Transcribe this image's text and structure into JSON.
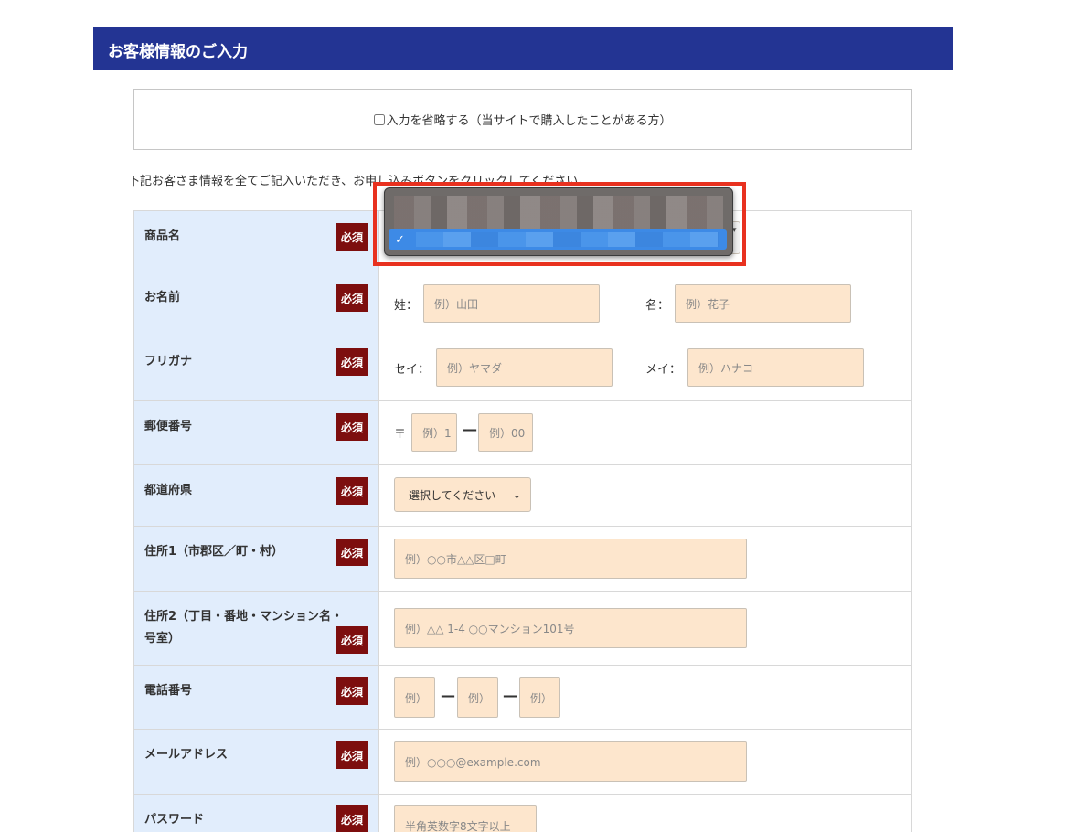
{
  "header": {
    "title": "お客様情報のご入力"
  },
  "skip": {
    "label": "入力を省略する（当サイトで購入したことがある方）"
  },
  "instruction": "下記お客さま情報を全てご記入いただき、お申し込みボタンをクリックしてください。",
  "required_label": "必須",
  "rows": {
    "product": {
      "label": "商品名"
    },
    "name": {
      "label": "お名前",
      "last_label": "姓：",
      "last_ph": "例）山田",
      "first_label": "名：",
      "first_ph": "例）花子"
    },
    "kana": {
      "label": "フリガナ",
      "last_label": "セイ：",
      "last_ph": "例）ヤマダ",
      "first_label": "メイ：",
      "first_ph": "例）ハナコ"
    },
    "postal": {
      "label": "郵便番号",
      "mark": "〒",
      "p1_ph": "例）1",
      "p2_ph": "例）00"
    },
    "prefecture": {
      "label": "都道府県",
      "selected": "選択してください"
    },
    "address1": {
      "label": "住所1（市郡区／町・村）",
      "ph": "例）○○市△△区□町"
    },
    "address2": {
      "label": "住所2（丁目・番地・マンション名・号室）",
      "ph": "例）△△ 1-4 ○○マンション101号"
    },
    "phone": {
      "label": "電話番号",
      "ph1": "例）",
      "ph2": "例）",
      "ph3": "例）"
    },
    "email": {
      "label": "メールアドレス",
      "ph": "例）○○○@example.com"
    },
    "password": {
      "label": "パスワード",
      "ph": "半角英数字8文字以上"
    }
  },
  "dropdown": {
    "checkmark": "✓"
  },
  "colors": {
    "header": "#233493",
    "label_bg": "#e1edfc",
    "required_bg": "#7d0e0e",
    "input_bg": "#fde6cd",
    "highlight": "#e8311f",
    "selected_option": "#3d8ae6"
  }
}
